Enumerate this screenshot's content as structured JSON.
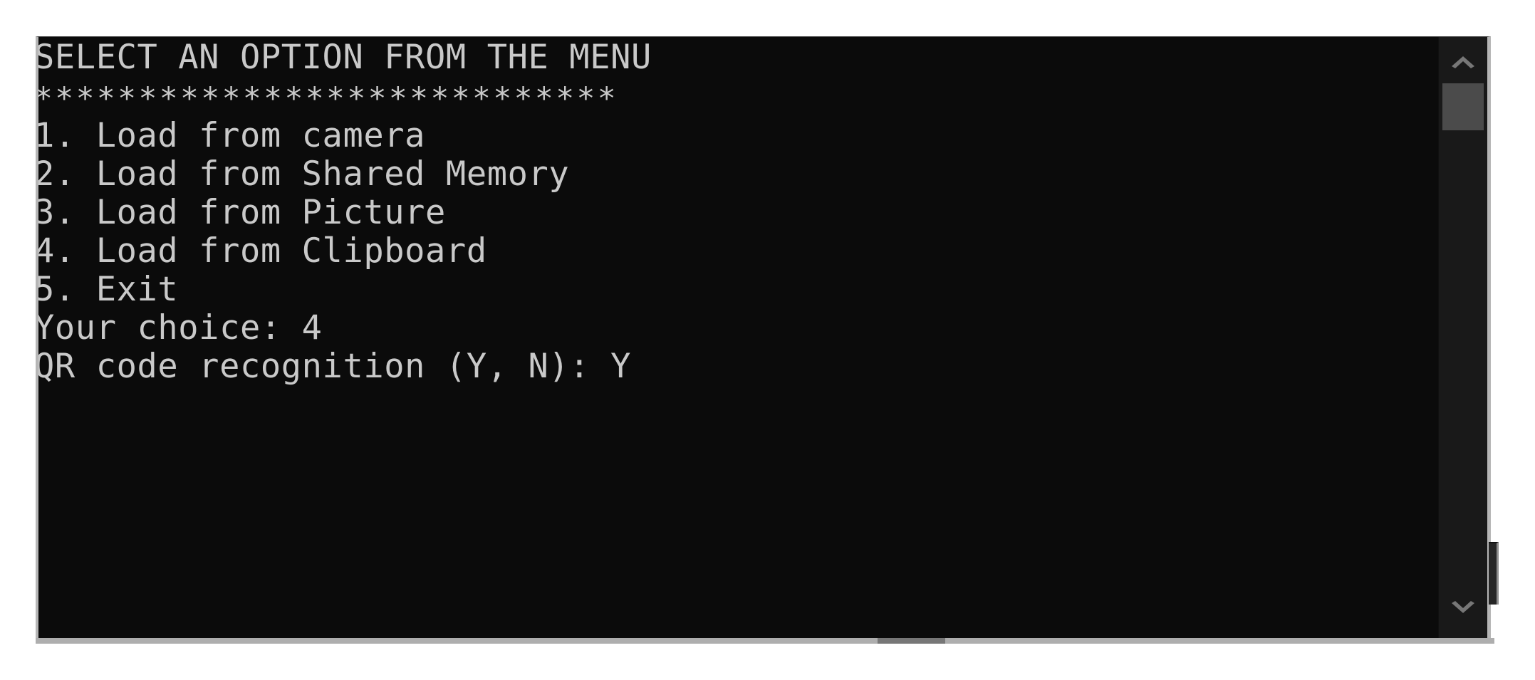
{
  "window": {
    "background_color": "#0b0b0b",
    "text_color": "#c9c9c9",
    "border_color": "#b6b6b6"
  },
  "console": {
    "title": "SELECT AN OPTION FROM THE MENU",
    "rule": "****************************",
    "menu_items": [
      "1. Load from camera",
      "2. Load from Shared Memory",
      "3. Load from Picture",
      "4. Load from Clipboard",
      "5. Exit"
    ],
    "prompts": [
      "Your choice: 4",
      "QR code recognition (Y, N): Y"
    ]
  },
  "scrollbar": {
    "up_arrow_icon": "chevron-up-icon",
    "down_arrow_icon": "chevron-down-icon",
    "thumb_color": "#4b4b4b",
    "track_color": "#191919"
  }
}
